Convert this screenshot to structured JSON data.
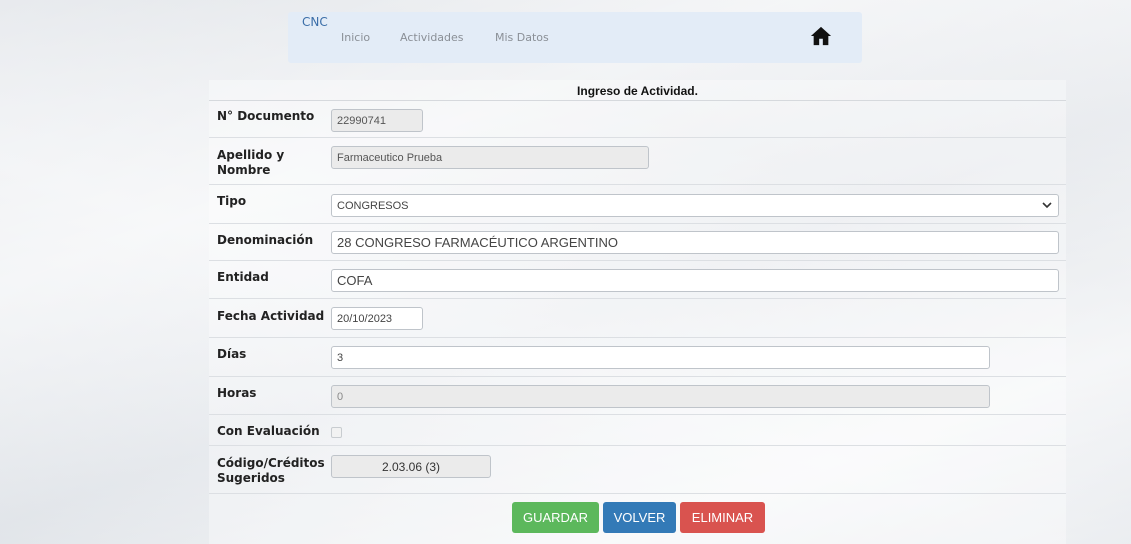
{
  "nav": {
    "brand": "CNC",
    "items": [
      {
        "label": "Inicio"
      },
      {
        "label": "Actividades"
      },
      {
        "label": "Mis Datos"
      }
    ],
    "home_icon": "home-icon"
  },
  "form": {
    "title": "Ingreso de Actividad.",
    "documento": {
      "label": "N° Documento",
      "value": "22990741"
    },
    "apellido": {
      "label_line1": "Apellido y",
      "label_line2": "Nombre",
      "value": "Farmaceutico Prueba"
    },
    "tipo": {
      "label": "Tipo",
      "value": "CONGRESOS"
    },
    "denominacion": {
      "label": "Denominación",
      "value": "28 CONGRESO FARMACÉUTICO ARGENTINO"
    },
    "entidad": {
      "label": "Entidad",
      "value": "COFA"
    },
    "fecha": {
      "label": "Fecha Actividad",
      "value": "20/10/2023"
    },
    "dias": {
      "label": "Días",
      "value": "3"
    },
    "horas": {
      "label": "Horas",
      "value": "0"
    },
    "evaluacion": {
      "label": "Con Evaluación",
      "checked": false
    },
    "codigo": {
      "label_line1": "Código/Créditos",
      "label_line2": "Sugeridos",
      "value": "2.03.06 (3)"
    }
  },
  "buttons": {
    "guardar": "GUARDAR",
    "volver": "VOLVER",
    "eliminar": "ELIMINAR"
  },
  "colors": {
    "guardar": "#5cb85c",
    "volver": "#337ab7",
    "eliminar": "#d9534f",
    "brand": "#3b6ea8"
  }
}
